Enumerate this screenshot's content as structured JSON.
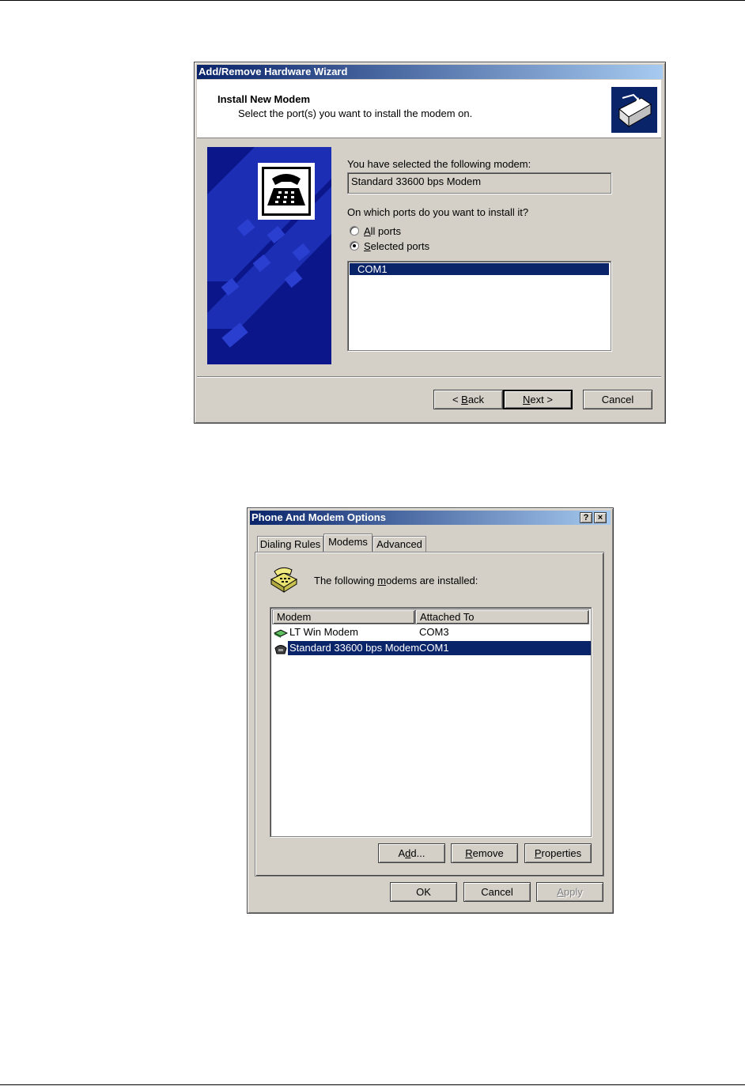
{
  "wizard": {
    "title": "Add/Remove Hardware Wizard",
    "header_title": "Install New Modem",
    "header_subtitle": "Select the port(s) you want to install the modem on.",
    "selected_label": "You have selected the following modem:",
    "selected_modem": "Standard 33600 bps Modem",
    "ports_question": "On which ports do you want to install it?",
    "radio_all": {
      "prefix": "",
      "accel": "A",
      "rest": "ll ports",
      "checked": false
    },
    "radio_selected": {
      "prefix": "",
      "accel": "S",
      "rest": "elected ports",
      "checked": true
    },
    "ports": [
      "COM1"
    ],
    "buttons": {
      "back": {
        "prefix": "< ",
        "accel": "B",
        "rest": "ack"
      },
      "next": {
        "prefix": "",
        "accel": "N",
        "rest": "ext >"
      },
      "cancel": "Cancel"
    }
  },
  "phone": {
    "title": "Phone And Modem Options",
    "help_glyph": "?",
    "close_glyph": "×",
    "tabs": [
      "Dialing Rules",
      "Modems",
      "Advanced"
    ],
    "active_tab": "Modems",
    "intro": {
      "pre": "The following ",
      "accel": "m",
      "post": "odems are  installed:"
    },
    "columns": [
      "Modem",
      "Attached To"
    ],
    "rows": [
      {
        "modem": "LT Win Modem",
        "port": "COM3",
        "icon": "green-modem-icon",
        "selected": false
      },
      {
        "modem": "Standard 33600 bps Modem",
        "port": "COM1",
        "icon": "phone-modem-icon",
        "selected": true
      }
    ],
    "buttons": {
      "add": {
        "prefix": "A",
        "accel": "d",
        "rest": "d..."
      },
      "remove": {
        "prefix": "",
        "accel": "R",
        "rest": "emove"
      },
      "properties": {
        "prefix": "",
        "accel": "P",
        "rest": "roperties"
      },
      "ok": "OK",
      "cancel": "Cancel",
      "apply": {
        "prefix": "",
        "accel": "A",
        "rest": "pply"
      }
    }
  },
  "colors": {
    "titlebar": "#0a246a",
    "face": "#d4d0c8",
    "selection": "#0a246a"
  }
}
